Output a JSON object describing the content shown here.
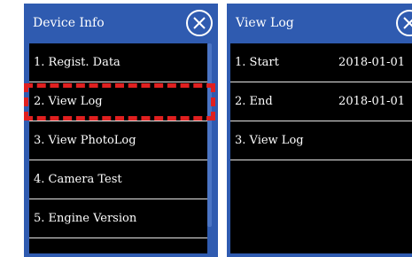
{
  "left_panel": {
    "title": "Device Info",
    "close_icon": "close-circle-x-icon",
    "items": [
      {
        "label": "1. Regist. Data"
      },
      {
        "label": "2. View Log"
      },
      {
        "label": "3. View PhotoLog"
      },
      {
        "label": "4. Camera Test"
      },
      {
        "label": "5. Engine Version"
      }
    ],
    "highlighted_item": "2. View Log"
  },
  "right_panel": {
    "title": "View Log",
    "close_icon": "close-circle-x-icon",
    "items": [
      {
        "label": "1. Start",
        "value": "2018-01-01"
      },
      {
        "label": "2. End",
        "value": "2018-01-01"
      },
      {
        "label": "3. View Log",
        "value": ""
      }
    ]
  },
  "colors": {
    "frame": "#2f5bb0",
    "list_background": "#000000",
    "text": "#ffffff",
    "highlight": "#e02020"
  }
}
